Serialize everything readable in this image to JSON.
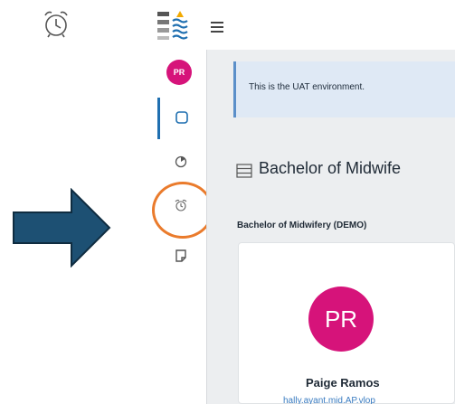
{
  "uat_banner": {
    "text": "This is the UAT environment."
  },
  "course": {
    "title": "Bachelor of Midwife",
    "subtitle": "Bachelor of Midwifery (DEMO)"
  },
  "user": {
    "initials_small": "PR",
    "initials_large": "PR",
    "name": "Paige Ramos",
    "email": "hally.ayant.mid.AP.vlop"
  },
  "nav": {
    "items": [
      {
        "icon": "square-icon",
        "active": true
      },
      {
        "icon": "clock-icon",
        "active": false
      },
      {
        "icon": "alarm-clock-icon",
        "active": false
      },
      {
        "icon": "note-icon",
        "active": false
      }
    ]
  },
  "colors": {
    "avatar": "#d6137a",
    "active_nav": "#1f6fb0",
    "highlight_circle": "#ea7b2c",
    "arrow_fill": "#1d5073",
    "banner_bg": "#dfe9f5"
  }
}
